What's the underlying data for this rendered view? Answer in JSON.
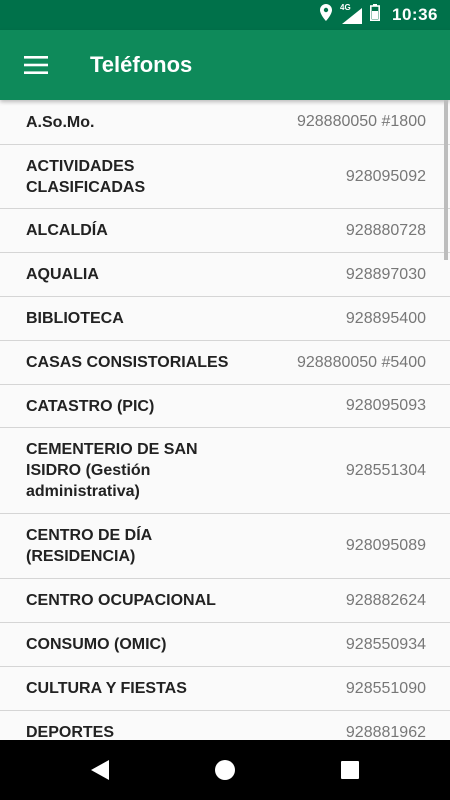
{
  "status_bar": {
    "time": "10:36",
    "network": "4G",
    "icons": [
      "location-icon",
      "signal-icon",
      "battery-icon"
    ]
  },
  "app_bar": {
    "title": "Teléfonos",
    "menu_icon": "hamburger-menu-icon"
  },
  "contacts": [
    {
      "name": "A.So.Mo.",
      "phone": "928880050 #1800"
    },
    {
      "name": "ACTIVIDADES CLASIFICADAS",
      "phone": "928095092"
    },
    {
      "name": "ALCALDÍA",
      "phone": "928880728"
    },
    {
      "name": "AQUALIA",
      "phone": "928897030"
    },
    {
      "name": "BIBLIOTECA",
      "phone": "928895400"
    },
    {
      "name": "CASAS CONSISTORIALES",
      "phone": "928880050 #5400"
    },
    {
      "name": "CATASTRO (PIC)",
      "phone": "928095093"
    },
    {
      "name": "CEMENTERIO DE SAN ISIDRO (Gestión administrativa)",
      "phone": "928551304"
    },
    {
      "name": "CENTRO DE DÍA (RESIDENCIA)",
      "phone": "928095089"
    },
    {
      "name": "CENTRO OCUPACIONAL",
      "phone": "928882624"
    },
    {
      "name": "CONSUMO (OMIC)",
      "phone": "928550934"
    },
    {
      "name": "CULTURA Y FIESTAS",
      "phone": "928551090"
    },
    {
      "name": "DEPORTES",
      "phone": "928881962"
    }
  ],
  "nav_bar": {
    "icons": [
      "back-icon",
      "home-icon",
      "recents-icon"
    ]
  },
  "colors": {
    "status_bar": "#00714a",
    "app_bar": "#0e8a5a",
    "name_text": "#222222",
    "phone_text": "#777777",
    "divider": "#d5d5d5"
  }
}
